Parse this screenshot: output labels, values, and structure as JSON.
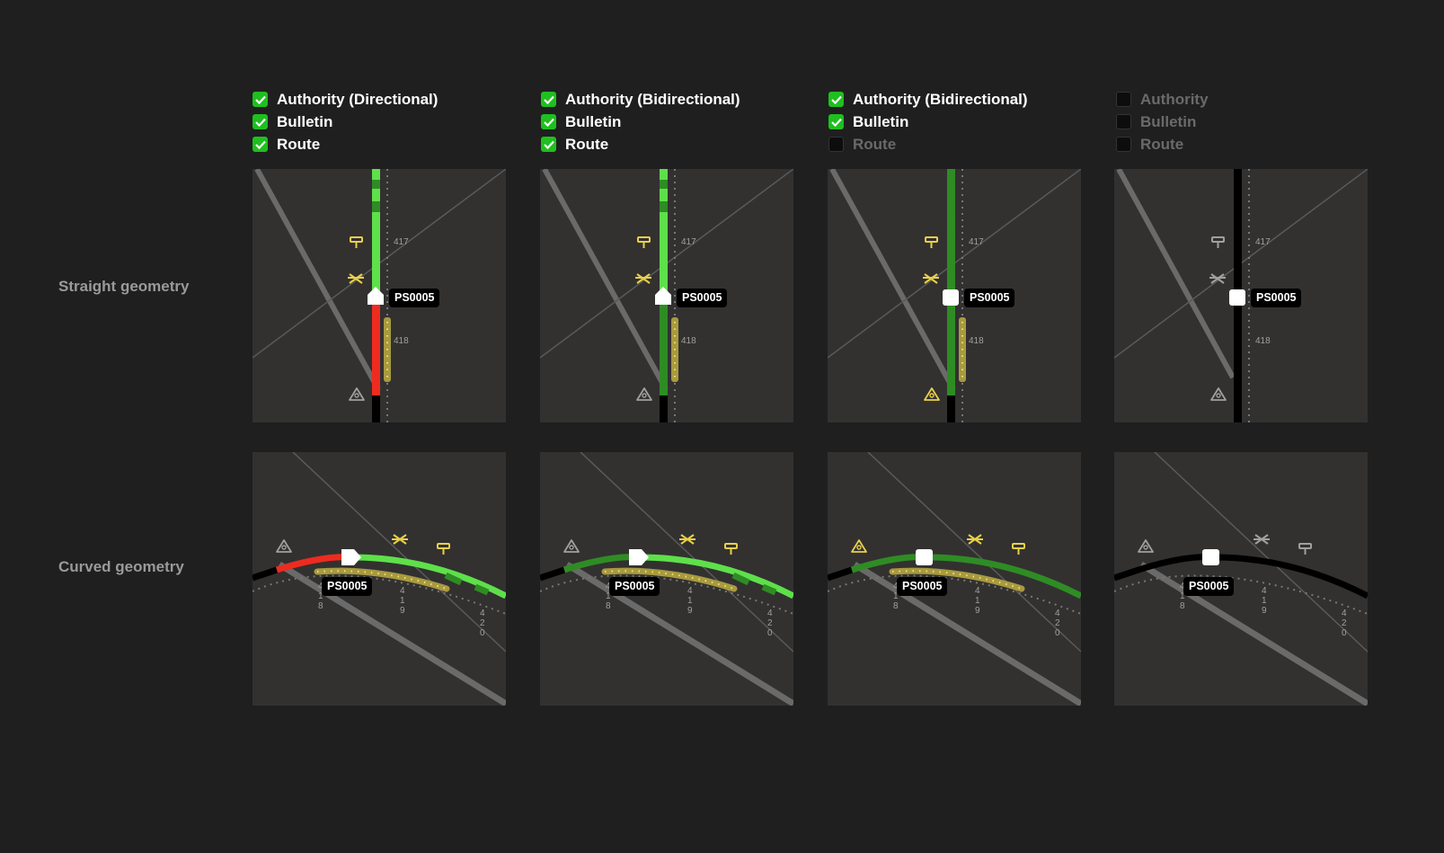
{
  "row_labels": {
    "straight": "Straight geometry",
    "curved": "Curved geometry"
  },
  "columns": [
    {
      "legend": [
        {
          "label": "Authority (Directional)",
          "checked": true
        },
        {
          "label": "Bulletin",
          "checked": true
        },
        {
          "label": "Route",
          "checked": true
        }
      ]
    },
    {
      "legend": [
        {
          "label": "Authority (Bidirectional)",
          "checked": true
        },
        {
          "label": "Bulletin",
          "checked": true
        },
        {
          "label": "Route",
          "checked": true
        }
      ]
    },
    {
      "legend": [
        {
          "label": "Authority (Bidirectional)",
          "checked": true
        },
        {
          "label": "Bulletin",
          "checked": true
        },
        {
          "label": "Route",
          "checked": false
        }
      ]
    },
    {
      "legend": [
        {
          "label": "Authority",
          "checked": false
        },
        {
          "label": "Bulletin",
          "checked": false
        },
        {
          "label": "Route",
          "checked": false
        }
      ]
    }
  ],
  "train_tag": "PS0005",
  "mileposts": {
    "straight": [
      "417",
      "418"
    ],
    "curved": [
      "418",
      "419",
      "420"
    ]
  },
  "icons": [
    "signal-icon",
    "crossing-icon",
    "switch-icon",
    "checkbox-check-icon"
  ],
  "colors": {
    "background": "#1f1f1f",
    "panel": "#323130",
    "authority_directional_red": "#ee2b1f",
    "route_bright_green": "#5ee04a",
    "authority_dark_green": "#2f8c24",
    "bulletin_yellow": "#e9d04a",
    "inactive_track": "#000000",
    "checkbox_on": "#1fbf1f"
  }
}
